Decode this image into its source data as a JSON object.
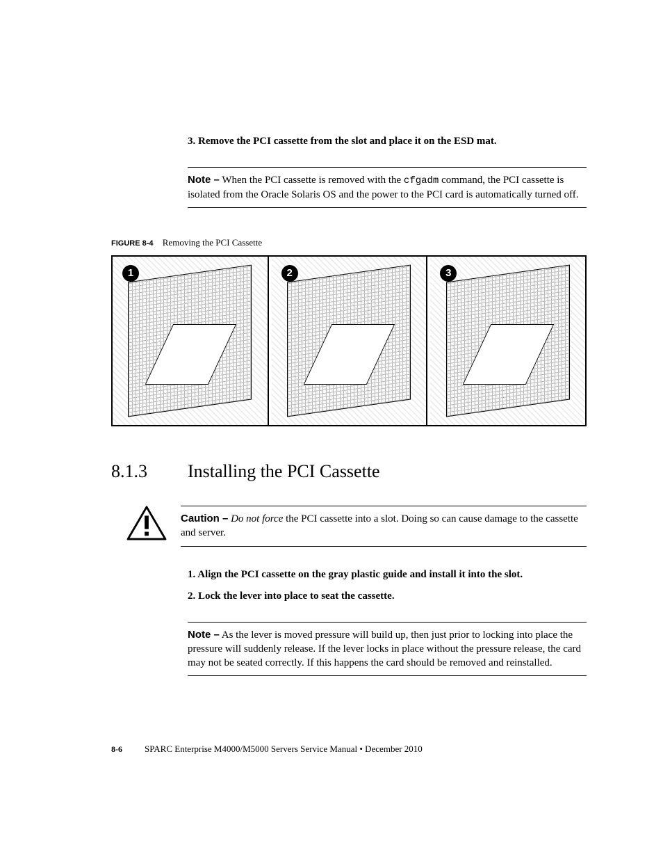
{
  "step3_num": "3.",
  "step3_text": "Remove the PCI cassette from the slot and place it on the ESD mat.",
  "note1_label": "Note –",
  "note1_pre": " When the PCI cassette is removed with the ",
  "note1_cmd": "cfgadm",
  "note1_post": " command, the PCI cassette is isolated from the Oracle Solaris OS and the power to the PCI card is automatically turned off.",
  "figure_label": "FIGURE 8-4",
  "figure_title": "Removing the PCI Cassette",
  "callouts": [
    "1",
    "2",
    "3"
  ],
  "heading_num": "8.1.3",
  "heading_title": "Installing the PCI Cassette",
  "caution_label": "Caution –",
  "caution_em": "Do not force",
  "caution_rest": " the PCI cassette into a slot. Doing so can cause damage to the cassette and server.",
  "step1_num": "1.",
  "step1_text": "Align the PCI cassette on the gray plastic guide and install it into the slot.",
  "step2_num": "2.",
  "step2_text": "Lock the lever into place to seat the cassette.",
  "note2_label": "Note –",
  "note2_text": " As the lever is moved pressure will build up, then just prior to locking into place the pressure will suddenly release. If the lever locks in place without the pressure release, the card may not be seated correctly. If this happens the card should be removed and reinstalled.",
  "footer_page": "8-6",
  "footer_text": "SPARC Enterprise M4000/M5000 Servers Service Manual  •  December 2010"
}
